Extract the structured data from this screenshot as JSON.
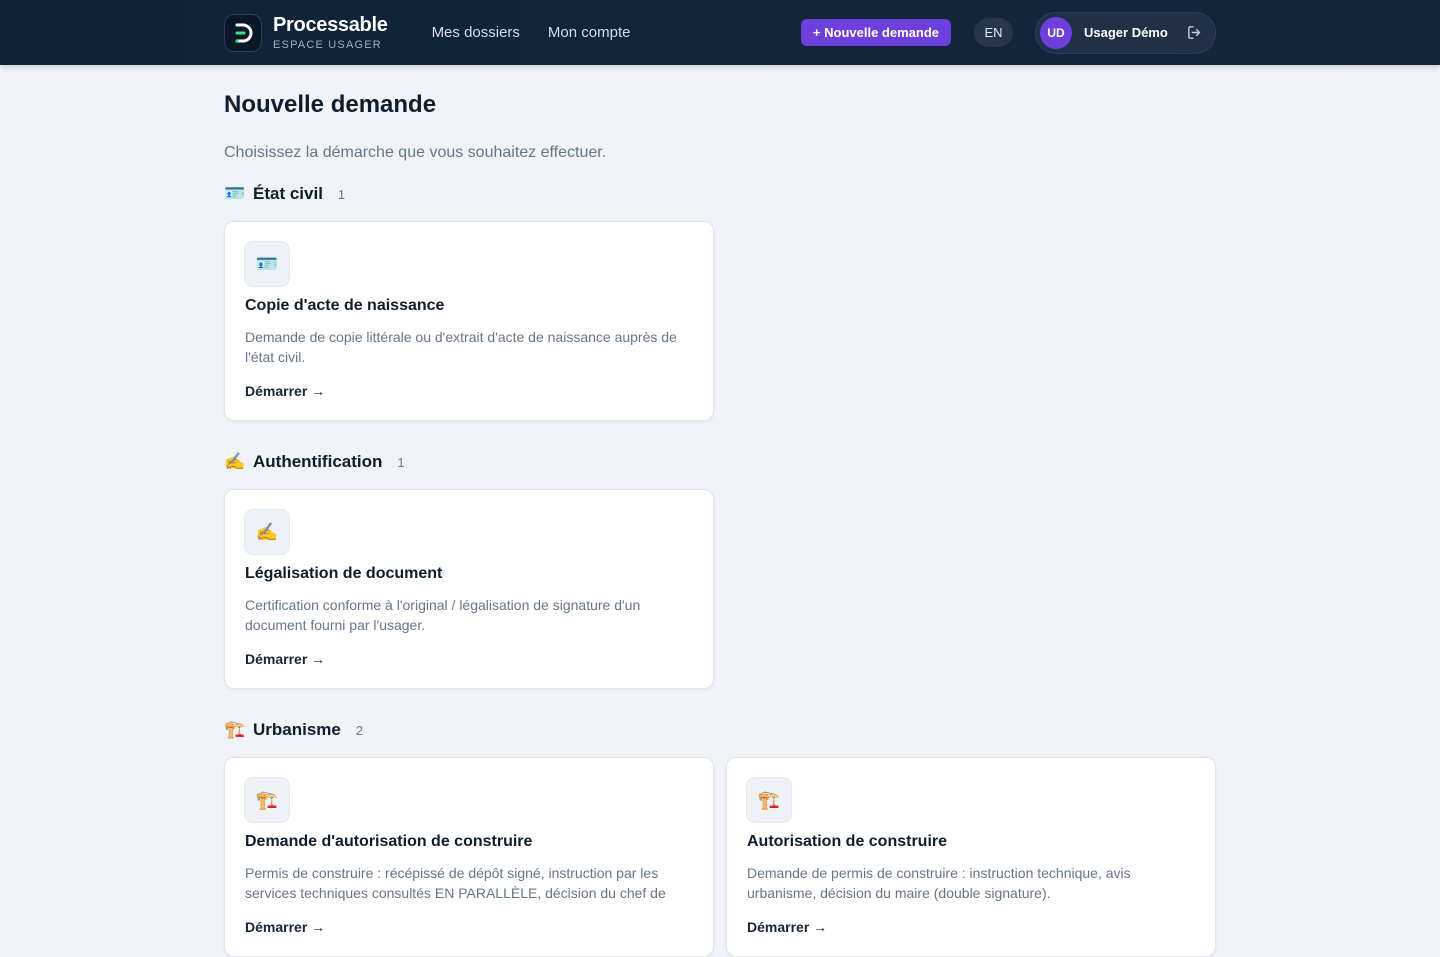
{
  "header": {
    "brand_name": "Processable",
    "brand_sub": "ESPACE USAGER",
    "nav": [
      {
        "label": "Mes dossiers"
      },
      {
        "label": "Mon compte"
      }
    ],
    "new_request_label": "+ Nouvelle demande",
    "language_label": "EN",
    "user": {
      "initials": "UD",
      "name": "Usager Démo"
    },
    "icons": {
      "logo": "processable-logo-icon",
      "logout": "logout-icon"
    }
  },
  "main": {
    "title": "Nouvelle demande",
    "subtitle": "Choisissez la démarche que vous souhaitez effectuer.",
    "sections": [
      {
        "emoji": "🪪",
        "title": "État civil",
        "count": "1",
        "cards": [
          {
            "emoji": "🪪",
            "title": "Copie d'acte de naissance",
            "description": "Demande de copie littérale ou d'extrait d'acte de naissance auprès de l'état civil.",
            "action": "Démarrer →"
          }
        ]
      },
      {
        "emoji": "✍️",
        "title": "Authentification",
        "count": "1",
        "cards": [
          {
            "emoji": "✍️",
            "title": "Légalisation de document",
            "description": "Certification conforme à l'original / légalisation de signature d'un document fourni par l'usager.",
            "action": "Démarrer →"
          }
        ]
      },
      {
        "emoji": "🏗️",
        "title": "Urbanisme",
        "count": "2",
        "cards": [
          {
            "emoji": "🏗️",
            "title": "Demande d'autorisation de construire",
            "description": "Permis de construire : récépissé de dépôt signé, instruction par les services techniques consultés EN PARALLÈLE, décision du chef de",
            "action": "Démarrer →"
          },
          {
            "emoji": "🏗️",
            "title": "Autorisation de construire",
            "description": "Demande de permis de construire : instruction technique, avis urbanisme, décision du maire (double signature).",
            "action": "Démarrer →"
          }
        ]
      }
    ]
  },
  "colors": {
    "header_bg": "#0e2238",
    "accent": "#6d3fdc",
    "page_bg": "#f0f3f8",
    "text_primary": "#0f1d2e",
    "text_muted": "#66768a"
  }
}
